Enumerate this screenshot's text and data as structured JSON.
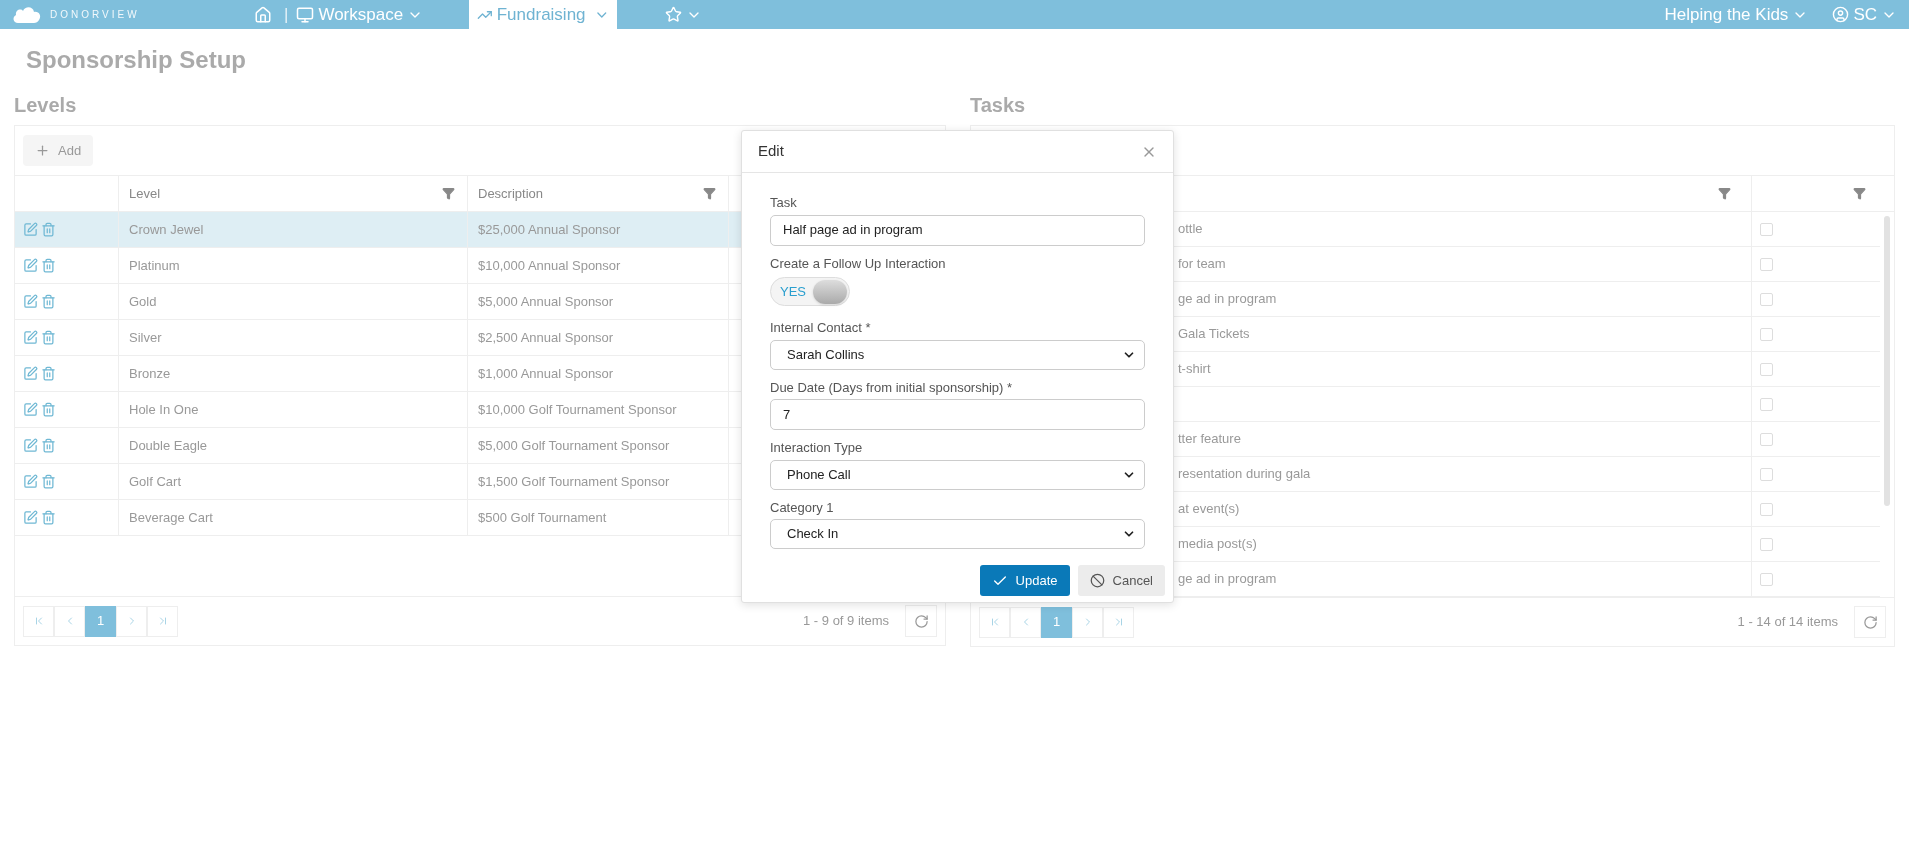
{
  "nav": {
    "logo": "DONORVIEW",
    "items": [
      {
        "kind": "home",
        "selected": false
      },
      {
        "kind": "workspace",
        "separator": "|",
        "label": "Workspace",
        "selected": false
      },
      {
        "kind": "fundraising",
        "label": "Fundraising",
        "selected": true
      },
      {
        "kind": "favorites",
        "selected": false
      }
    ],
    "org": "Helping the Kids",
    "user": "SC"
  },
  "page_title": "Sponsorship Setup",
  "levels": {
    "title": "Levels",
    "add_button": "Add",
    "columns": [
      "Level",
      "Description"
    ],
    "rows": [
      {
        "level": "Crown Jewel",
        "description": "$25,000 Annual Sponsor",
        "selected": true
      },
      {
        "level": "Platinum",
        "description": "$10,000 Annual Sponsor",
        "selected": false
      },
      {
        "level": "Gold",
        "description": "$5,000 Annual Sponsor",
        "selected": false
      },
      {
        "level": "Silver",
        "description": "$2,500 Annual Sponsor",
        "selected": false
      },
      {
        "level": "Bronze",
        "description": "$1,000 Annual Sponsor",
        "selected": false
      },
      {
        "level": "Hole In One",
        "description": "$10,000 Golf Tournament Sponsor",
        "selected": false
      },
      {
        "level": "Double Eagle",
        "description": "$5,000 Golf Tournament Sponsor",
        "selected": false
      },
      {
        "level": "Golf Cart",
        "description": "$1,500 Golf Tournament Sponsor",
        "selected": false
      },
      {
        "level": "Beverage Cart",
        "description": "$500 Golf Tournament",
        "selected": false
      }
    ],
    "pager": {
      "pages": [
        {
          "label": "1",
          "selected": true
        }
      ],
      "summary": "1 - 9 of 9 items"
    }
  },
  "tasks": {
    "title": "Tasks",
    "rows": [
      {
        "task": "ottle",
        "checked": false
      },
      {
        "task": "for team",
        "checked": false
      },
      {
        "task": "ge ad in program",
        "checked": false
      },
      {
        "task": "Gala Tickets",
        "checked": false
      },
      {
        "task": "t-shirt",
        "checked": false
      },
      {
        "checked": false
      },
      {
        "task": "tter feature",
        "checked": false
      },
      {
        "task": "resentation during gala",
        "checked": false
      },
      {
        "task": "at event(s)",
        "checked": false
      },
      {
        "task": "media post(s)",
        "checked": false
      },
      {
        "task": "ge ad in program",
        "checked": false
      }
    ],
    "pager": {
      "pages": [
        {
          "label": "1",
          "selected": true
        }
      ],
      "summary": "1 - 14 of 14 items"
    }
  },
  "dialog": {
    "title": "Edit",
    "fields": [
      {
        "kind": "text",
        "label": "Task",
        "value": "Half page ad in program"
      },
      {
        "kind": "toggle",
        "label": "Create a Follow Up Interaction",
        "toggle_label": "YES",
        "on": true
      },
      {
        "kind": "select",
        "label": "Internal Contact *",
        "value": "Sarah Collins"
      },
      {
        "kind": "text",
        "label": "Due Date (Days from initial sponsorship) *",
        "value": "7"
      },
      {
        "kind": "select",
        "label": "Interaction Type",
        "value": "Phone Call"
      },
      {
        "kind": "select",
        "label": "Category 1",
        "value": "Check In"
      }
    ],
    "buttons": [
      {
        "kind": "primary",
        "label": "Update"
      },
      {
        "kind": "secondary",
        "label": "Cancel"
      }
    ]
  }
}
